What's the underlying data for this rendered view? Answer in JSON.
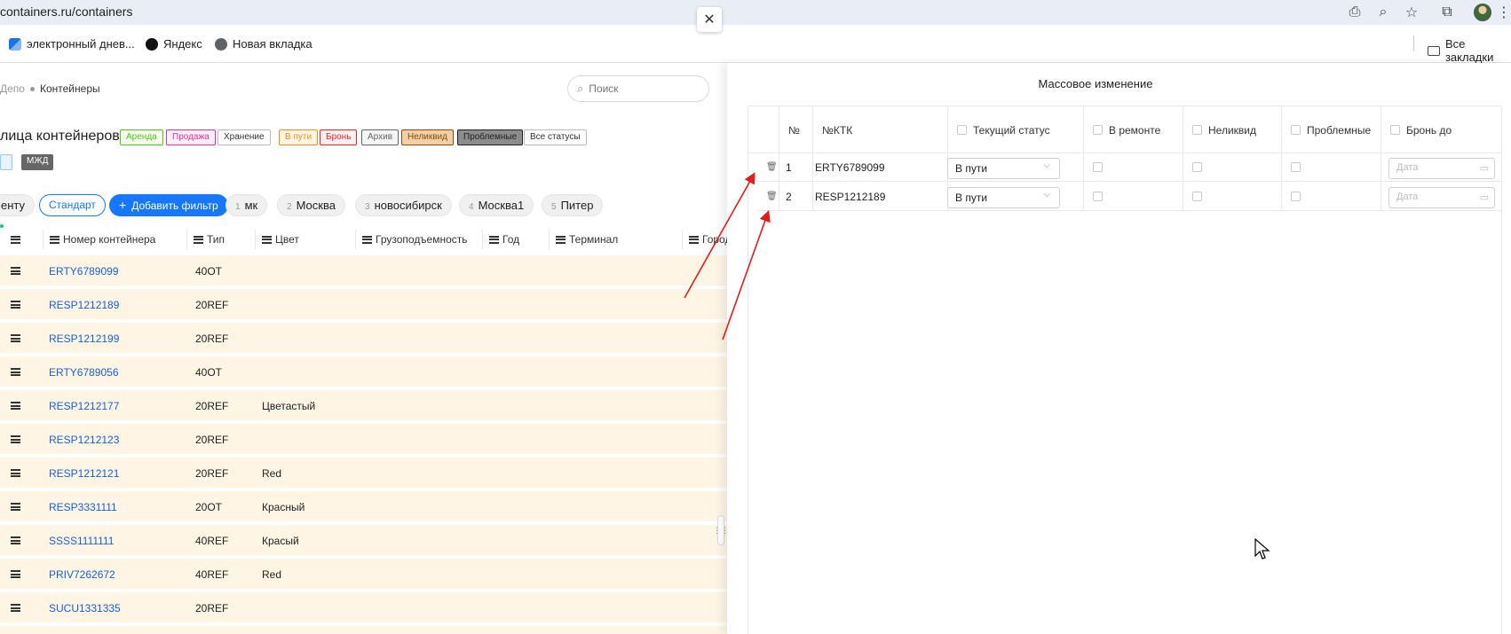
{
  "browser": {
    "url": "containers.ru/containers",
    "bookmarks": [
      {
        "label": "электронный днев...",
        "color": "#1a73e8"
      },
      {
        "label": "Яндекс",
        "color": "#000000"
      },
      {
        "label": "Новая вкладка",
        "color": "#5f6368"
      }
    ],
    "all_bookmarks": "Все закладки"
  },
  "app": {
    "breadcrumb": {
      "parent": "Депо",
      "current": "Контейнеры"
    },
    "search_placeholder": "Поиск",
    "close_symbol": "✕",
    "page_title": "лица контейнеров",
    "status_tags": [
      {
        "label": "Аренда",
        "color": "#52c41a",
        "bg": "#f6ffed"
      },
      {
        "label": "Продажа",
        "color": "#eb2f96",
        "bg": "#fff0f6"
      },
      {
        "label": "Хранение",
        "color": "#333333",
        "bg": "#ffffff"
      },
      {
        "label": "В пути",
        "color": "#fa8c16",
        "bg": "#fff7e6"
      },
      {
        "label": "Бронь",
        "color": "#f5222d",
        "bg": "#fff1f0"
      },
      {
        "label": "Архив",
        "color": "#666666",
        "bg": "#f5f5f5"
      },
      {
        "label": "Неликвид",
        "color": "#874d00",
        "bg": "#f3cfa8"
      },
      {
        "label": "Проблемные",
        "color": "#222222",
        "bg": "#8c8c8c"
      },
      {
        "label": "Все статусы",
        "color": "#333333",
        "bg": "#ffffff"
      }
    ],
    "tag_mzhd": "МЖД",
    "filters": {
      "clipped_label": "енту",
      "standard": "Стандарт",
      "add_filter": "Добавить фильтр",
      "saved": [
        {
          "num": "1",
          "label": "мк"
        },
        {
          "num": "2",
          "label": "Москва"
        },
        {
          "num": "3",
          "label": "новосибирск"
        },
        {
          "num": "4",
          "label": "Москва1"
        },
        {
          "num": "5",
          "label": "Питер"
        }
      ]
    },
    "columns": [
      "Номер контейнера",
      "Тип",
      "Цвет",
      "Грузоподъемность",
      "Год",
      "Терминал",
      "Город"
    ],
    "rows": [
      {
        "number": "ERTY6789099",
        "type": "40OT",
        "color": ""
      },
      {
        "number": "RESP1212189",
        "type": "20REF",
        "color": ""
      },
      {
        "number": "RESP1212199",
        "type": "20REF",
        "color": ""
      },
      {
        "number": "ERTY6789056",
        "type": "40OT",
        "color": ""
      },
      {
        "number": "RESP1212177",
        "type": "20REF",
        "color": "Цветастый"
      },
      {
        "number": "RESP1212123",
        "type": "20REF",
        "color": ""
      },
      {
        "number": "RESP1212121",
        "type": "20REF",
        "color": "Red"
      },
      {
        "number": "RESP3331111",
        "type": "20OT",
        "color": "Красный"
      },
      {
        "number": "SSSS1111111",
        "type": "40REF",
        "color": "Красый"
      },
      {
        "number": "PRIV7262672",
        "type": "40REF",
        "color": "Red"
      },
      {
        "number": "SUCU1331335",
        "type": "20REF",
        "color": ""
      }
    ]
  },
  "panel": {
    "title": "Массовое изменение",
    "headers": {
      "num": "№",
      "ktk": "№КТК",
      "status": "Текущий статус",
      "repair": "В ремонте",
      "illiquid": "Неликвид",
      "problem": "Проблемные",
      "booking": "Бронь до"
    },
    "rows": [
      {
        "n": "1",
        "ktk": "ERTY6789099",
        "status": "В пути",
        "date_placeholder": "Дата"
      },
      {
        "n": "2",
        "ktk": "RESP1212189",
        "status": "В пути",
        "date_placeholder": "Дата"
      }
    ]
  }
}
